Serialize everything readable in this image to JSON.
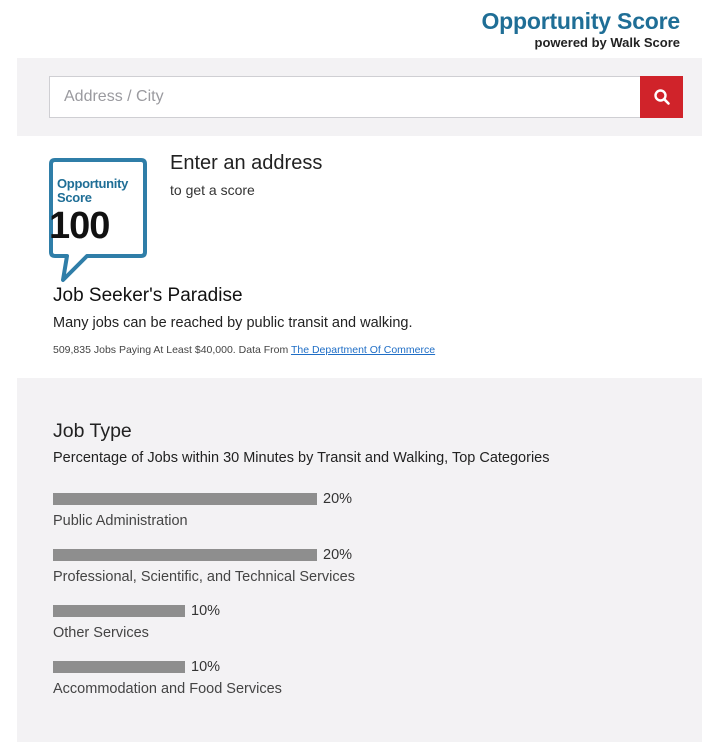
{
  "brand": {
    "title": "Opportunity Score",
    "subtitle": "powered by Walk Score",
    "color": "#1f6e96"
  },
  "search": {
    "placeholder": "Address / City",
    "value": "",
    "button_icon": "search-icon",
    "button_color": "#d0232a"
  },
  "score": {
    "badge_label": "Opportunity Score",
    "badge_value": "100",
    "prompt_title": "Enter an address",
    "prompt_sub": "to get a score",
    "title": "Job Seeker's Paradise",
    "description": "Many jobs can be reached by public transit and walking.",
    "source_text": "509,835 Jobs Paying At Least $40,000. Data From ",
    "source_link": "The Department Of Commerce"
  },
  "jobs": {
    "title": "Job Type",
    "subtitle": "Percentage of Jobs within 30 Minutes by Transit and Walking, Top Categories",
    "items": [
      {
        "label": "Public Administration",
        "percent_text": "20%",
        "percent": 20
      },
      {
        "label": "Professional, Scientific, and Technical Services",
        "percent_text": "20%",
        "percent": 20
      },
      {
        "label": "Other Services",
        "percent_text": "10%",
        "percent": 10
      },
      {
        "label": "Accommodation and Food Services",
        "percent_text": "10%",
        "percent": 10
      }
    ]
  }
}
